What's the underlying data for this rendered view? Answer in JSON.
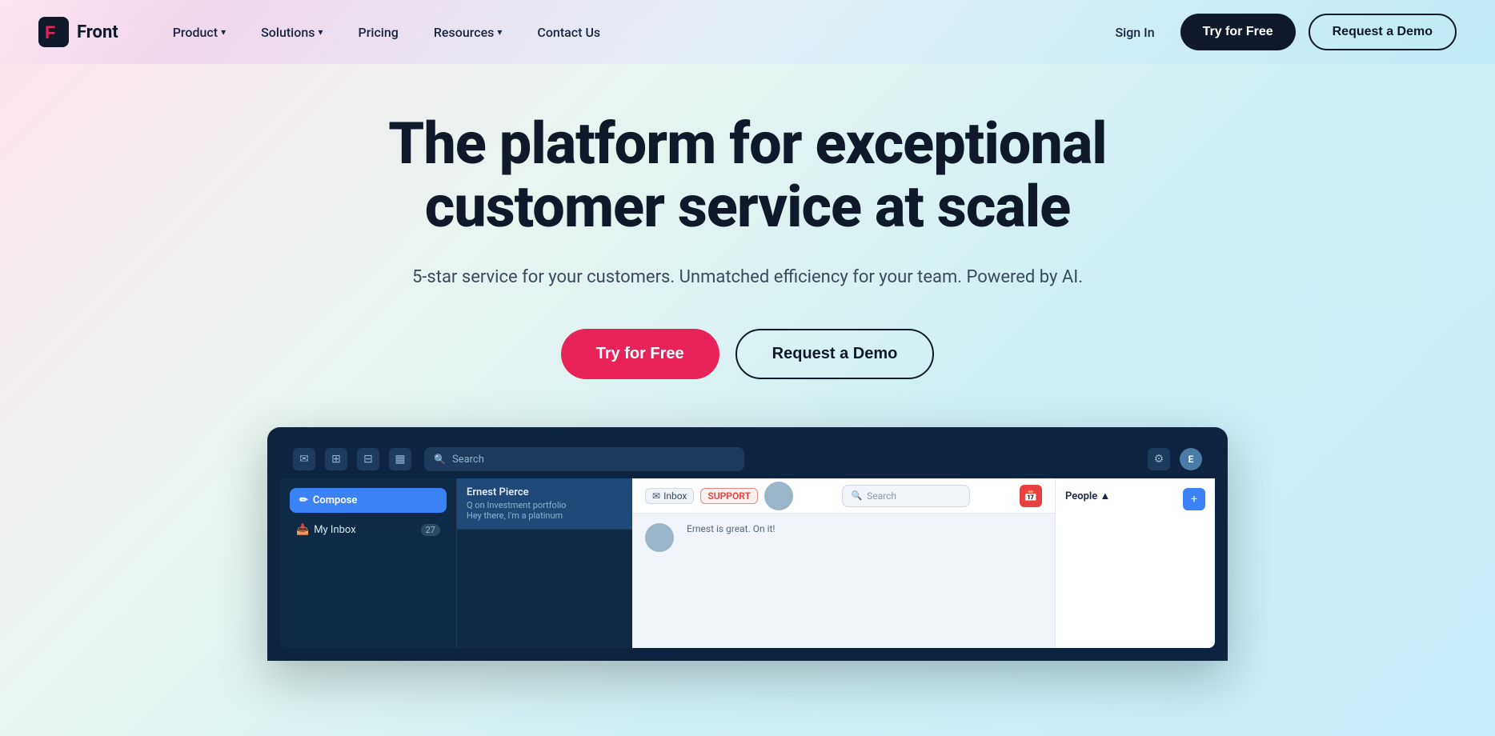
{
  "brand": {
    "name": "Front",
    "logo_letter": "F"
  },
  "navbar": {
    "links": [
      {
        "id": "product",
        "label": "Product"
      },
      {
        "id": "solutions",
        "label": "Solutions"
      },
      {
        "id": "pricing",
        "label": "Pricing"
      },
      {
        "id": "resources",
        "label": "Resources"
      },
      {
        "id": "contact",
        "label": "Contact Us"
      }
    ],
    "sign_in_label": "Sign In",
    "try_free_label": "Try for Free",
    "request_demo_label": "Request a Demo"
  },
  "hero": {
    "title_line1": "The platform for exceptional",
    "title_line2": "customer service at scale",
    "subtitle": "5-star service for your customers. Unmatched efficiency for your team. Powered by AI.",
    "try_free_label": "Try for Free",
    "request_demo_label": "Request a Demo"
  },
  "app_screenshot": {
    "search_placeholder": "Search",
    "compose_label": "Compose",
    "sidebar_inbox_label": "My Inbox",
    "sidebar_inbox_count": "27",
    "message_name": "Ernest Pierce",
    "message_subject": "Q on Investment portfolio",
    "message_preview": "Hey there, I'm a platinum",
    "inbox_badge": "Inbox",
    "support_badge": "SUPPORT",
    "main_search_placeholder": "Search",
    "right_panel_title": "People ▲",
    "main_body_text": "Ernest is great. On it!"
  },
  "colors": {
    "nav_dark": "#0f1929",
    "try_free_nav_bg": "#0f1929",
    "try_free_hero_bg": "#e8235a",
    "logo_pink": "#e8235a",
    "logo_dark": "#0f1929"
  }
}
